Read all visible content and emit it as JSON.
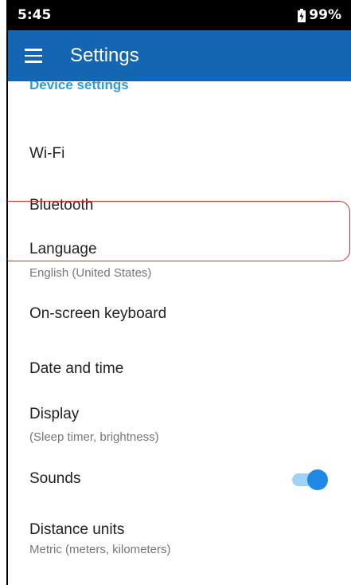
{
  "status_bar": {
    "time": "5:45",
    "battery": "99%"
  },
  "app_bar": {
    "menu_icon": "menu-icon",
    "title": "Settings"
  },
  "section_header": "Device settings",
  "items": [
    {
      "label": "Wi-Fi",
      "sub": ""
    },
    {
      "label": "Bluetooth",
      "sub": ""
    },
    {
      "label": "Language",
      "sub": "English (United States)"
    },
    {
      "label": "On-screen keyboard",
      "sub": ""
    },
    {
      "label": "Date and time",
      "sub": ""
    },
    {
      "label": "Display",
      "sub": "(Sleep timer, brightness)"
    },
    {
      "label": "Sounds",
      "sub": "",
      "toggle_on": true
    },
    {
      "label": "Distance units",
      "sub": "Metric (meters, kilometers)"
    }
  ],
  "colors": {
    "app_bar": "#1466b3",
    "section_header": "#2d9cdb",
    "toggle_track": "#9ed2f6",
    "toggle_knob": "#1e88e5",
    "highlight": "#d32f2f"
  }
}
